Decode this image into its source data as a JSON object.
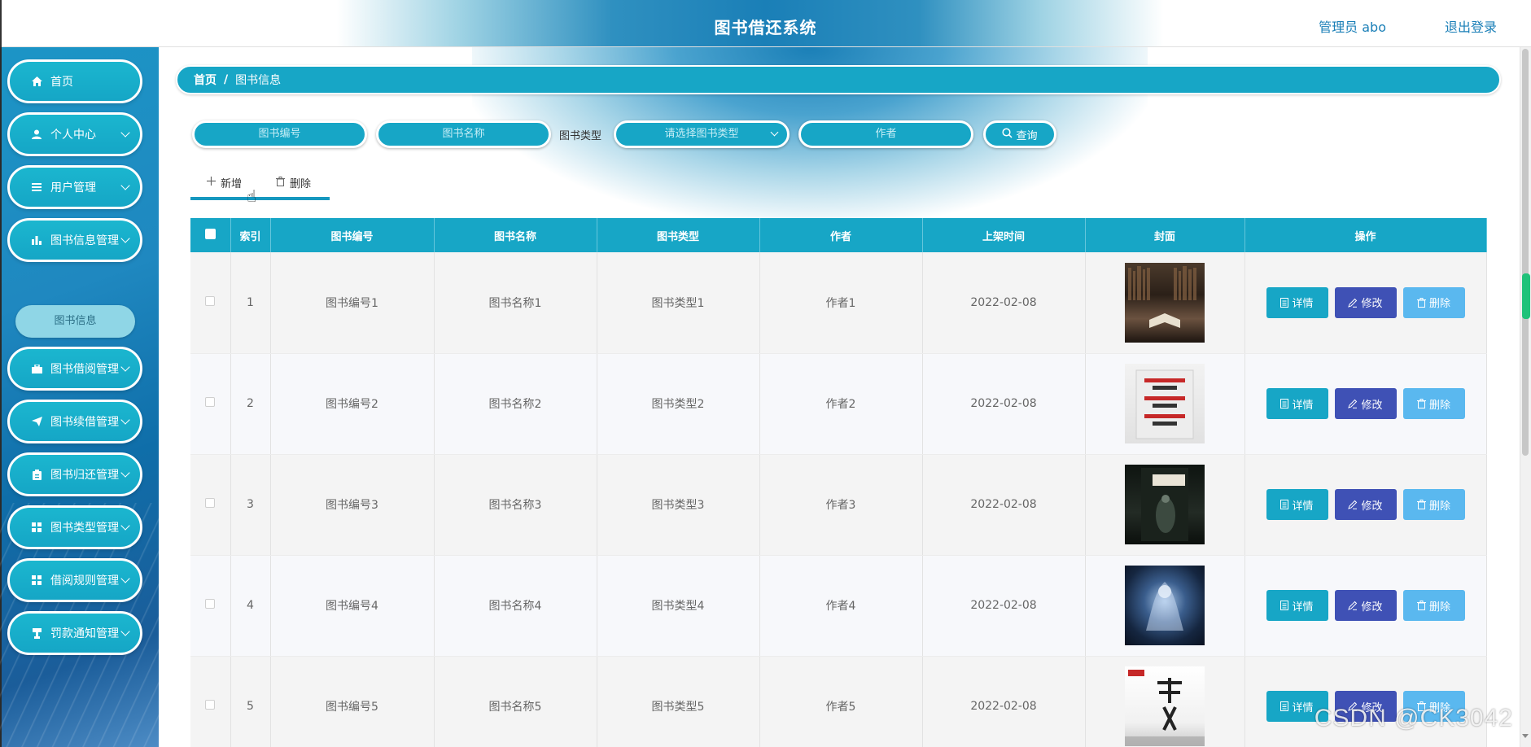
{
  "header": {
    "app_title": "图书借还系统",
    "user_label": "管理员 abo",
    "logout_label": "退出登录"
  },
  "sidebar": {
    "items": [
      {
        "label": "首页",
        "icon": "home-icon"
      },
      {
        "label": "个人中心",
        "icon": "user-icon"
      },
      {
        "label": "用户管理",
        "icon": "list-icon"
      },
      {
        "label": "图书信息管理",
        "icon": "bar-chart-icon"
      },
      {
        "label": "图书借阅管理",
        "icon": "briefcase-icon"
      },
      {
        "label": "图书续借管理",
        "icon": "paper-plane-icon"
      },
      {
        "label": "图书归还管理",
        "icon": "clipboard-icon"
      },
      {
        "label": "图书类型管理",
        "icon": "grid-icon"
      },
      {
        "label": "借阅规则管理",
        "icon": "grid-icon"
      },
      {
        "label": "罚款通知管理",
        "icon": "stamp-icon"
      }
    ],
    "active_submenu": "图书信息"
  },
  "breadcrumb": {
    "home": "首页",
    "separator": "/",
    "current": "图书信息"
  },
  "search": {
    "book_no_placeholder": "图书编号",
    "book_name_placeholder": "图书名称",
    "type_label": "图书类型",
    "type_placeholder": "请选择图书类型",
    "author_placeholder": "作者",
    "search_button": "查询"
  },
  "toolbar": {
    "add_label": "新增",
    "delete_label": "删除"
  },
  "table": {
    "headers": [
      "索引",
      "图书编号",
      "图书名称",
      "图书类型",
      "作者",
      "上架时间",
      "封面",
      "操作"
    ],
    "rows": [
      {
        "index": "1",
        "book_no": "图书编号1",
        "name": "图书名称1",
        "type": "图书类型1",
        "author": "作者1",
        "date": "2022-02-08"
      },
      {
        "index": "2",
        "book_no": "图书编号2",
        "name": "图书名称2",
        "type": "图书类型2",
        "author": "作者2",
        "date": "2022-02-08"
      },
      {
        "index": "3",
        "book_no": "图书编号3",
        "name": "图书名称3",
        "type": "图书类型3",
        "author": "作者3",
        "date": "2022-02-08"
      },
      {
        "index": "4",
        "book_no": "图书编号4",
        "name": "图书名称4",
        "type": "图书类型4",
        "author": "作者4",
        "date": "2022-02-08"
      },
      {
        "index": "5",
        "book_no": "图书编号5",
        "name": "图书名称5",
        "type": "图书类型5",
        "author": "作者5",
        "date": "2022-02-08"
      }
    ],
    "actions": {
      "detail": "详情",
      "edit": "修改",
      "delete": "删除"
    }
  },
  "watermark": "CSDN @CK3042",
  "colors": {
    "primary": "#17a6c6",
    "edit": "#3f51b5",
    "delete": "#5ab8ef",
    "title_link": "#1a7fb7"
  }
}
